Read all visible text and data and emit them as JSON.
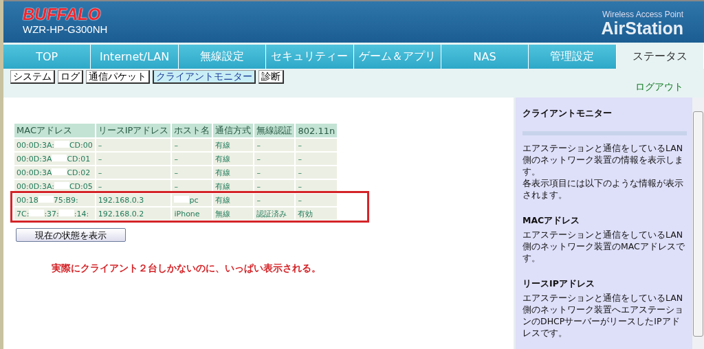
{
  "header": {
    "brand": "BUFFALO",
    "model": "WZR-HP-G300NH",
    "product_caption": "Wireless Access Point",
    "product_name": "AirStation"
  },
  "tabs": [
    {
      "label": "TOP",
      "selected": false
    },
    {
      "label": "Internet/LAN",
      "selected": false
    },
    {
      "label": "無線設定",
      "selected": false
    },
    {
      "label": "セキュリティー",
      "selected": false
    },
    {
      "label": "ゲーム＆アプリ",
      "selected": false
    },
    {
      "label": "NAS",
      "selected": false
    },
    {
      "label": "管理設定",
      "selected": false
    },
    {
      "label": "ステータス",
      "selected": true
    }
  ],
  "subtabs": [
    {
      "label": "システム",
      "selected": false
    },
    {
      "label": "ログ",
      "selected": false
    },
    {
      "label": "通信パケット",
      "selected": false
    },
    {
      "label": "クライアントモニター",
      "selected": true
    },
    {
      "label": "診断",
      "selected": false
    }
  ],
  "logout": "ログアウト",
  "table": {
    "columns": [
      "MACアドレス",
      "リースIPアドレス",
      "ホスト名",
      "通信方式",
      "無線認証",
      "802.11n"
    ],
    "rows": [
      {
        "mac_parts": [
          "00:0D:3A:",
          "CD:00"
        ],
        "ip": "–",
        "host": "–",
        "mode": "有線",
        "auth": "–",
        "n": "–"
      },
      {
        "mac_parts": [
          "00:0D:3A",
          "CD:01"
        ],
        "ip": "–",
        "host": "–",
        "mode": "有線",
        "auth": "–",
        "n": "–"
      },
      {
        "mac_parts": [
          "00:0D:3A",
          "CD:02"
        ],
        "ip": "–",
        "host": "–",
        "mode": "有線",
        "auth": "–",
        "n": "–"
      },
      {
        "mac_parts": [
          "00:0D:3A:",
          "CD:05"
        ],
        "ip": "–",
        "host": "–",
        "mode": "有線",
        "auth": "–",
        "n": "–"
      }
    ],
    "framed_rows": [
      {
        "mac_parts": [
          "00:18",
          "75:B9:"
        ],
        "ip": "192.168.0.3",
        "host": "pc",
        "host_redacted": true,
        "mode": "有線",
        "auth": "–",
        "n": "–"
      },
      {
        "mac_parts": [
          "7C:",
          ":37:",
          ":14:"
        ],
        "ip": "192.168.0.2",
        "host": "iPhone",
        "host_redacted": false,
        "mode": "無線",
        "auth": "認証済み",
        "n": "有効"
      }
    ]
  },
  "refresh_button": "現在の状態を表示",
  "annotation": "実際にクライアント２台しかないのに、いっぱい表示される。",
  "help": {
    "title": "クライアントモニター",
    "sections": [
      {
        "paragraphs": [
          "エアステーションと通信をしているLAN側のネットワーク装置の情報を表示します。",
          "各表示項目には以下のような情報が表示されます。"
        ]
      },
      {
        "heading": "MACアドレス",
        "paragraphs": [
          "エアステーションと通信をしているLAN側のネットワーク装置のMACアドレスです。"
        ]
      },
      {
        "heading": "リースIPアドレス",
        "paragraphs": [
          "エアステーションと通信をしているLAN側のネットワーク装置へエアステーションのDHCPサーバーがリースしたIPアドレスです。"
        ]
      }
    ]
  }
}
